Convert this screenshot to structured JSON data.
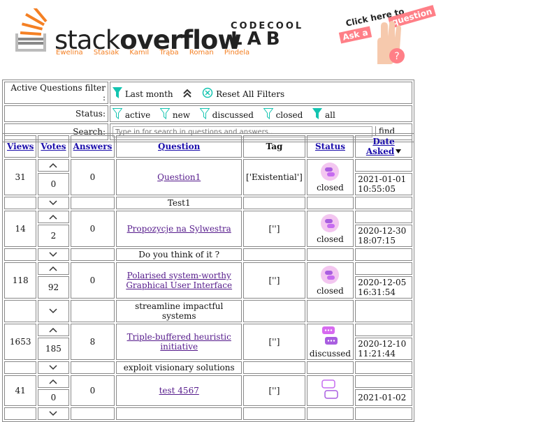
{
  "header": {
    "logo_prefix": "stack",
    "logo_bold": "overflow",
    "authors": "Ewelina Stasiak  Kamil Trąba  Roman Pindela",
    "codecool_top": "CODECOOL",
    "codecool_lab": "LAB",
    "ask_line1": "Click here to",
    "ask_a": "Ask a",
    "ask_q": "question",
    "accent": "#f48024",
    "pink": "#ff7f87"
  },
  "filters": {
    "active_label": "Active Questions filter :",
    "last_month": "Last month",
    "reset": "Reset All Filters",
    "status_label": "Status:",
    "statuses": [
      "active",
      "new",
      "discussed",
      "closed",
      "all"
    ],
    "search_label": "Search:",
    "search_placeholder": "Type in for search in questions and answers..",
    "find": "find"
  },
  "table": {
    "headers": {
      "views": "Views",
      "votes": "Votes",
      "answers": "Answers",
      "question": "Question",
      "tag": "Tag",
      "status": "Status",
      "date": "Date Asked"
    },
    "rows": [
      {
        "views": "31",
        "votes": "0",
        "answers": "0",
        "title": "Question1",
        "tag": "['Existential']",
        "status": "closed",
        "date": "2021-01-01",
        "time": "10:55:05",
        "message": "Test1"
      },
      {
        "views": "14",
        "votes": "2",
        "answers": "0",
        "title": "Propozycje na Sylwestra",
        "tag": "['']",
        "status": "closed",
        "date": "2020-12-30",
        "time": "18:07:15",
        "message": "Do you think of it ?"
      },
      {
        "views": "118",
        "votes": "92",
        "answers": "0",
        "title": "Polarised system-worthy Graphical User Interface",
        "tag": "['']",
        "status": "closed",
        "date": "2020-12-05",
        "time": "16:31:54",
        "message": "streamline impactful systems"
      },
      {
        "views": "1653",
        "votes": "185",
        "answers": "8",
        "title": "Triple-buffered heuristic initiative",
        "tag": "['']",
        "status": "discussed",
        "date": "2020-12-10",
        "time": "11:21:44",
        "message": "exploit visionary solutions"
      },
      {
        "views": "41",
        "votes": "0",
        "answers": "0",
        "title": "test 4567",
        "tag": "['']",
        "status": "",
        "date": "2021-01-02",
        "time": "",
        "message": ""
      }
    ]
  },
  "icons": {
    "up": "chevron-up-icon",
    "down": "chevron-down-icon",
    "filter": "funnel-icon",
    "reset": "reset-filter-icon",
    "sort": "sort-desc-icon"
  }
}
